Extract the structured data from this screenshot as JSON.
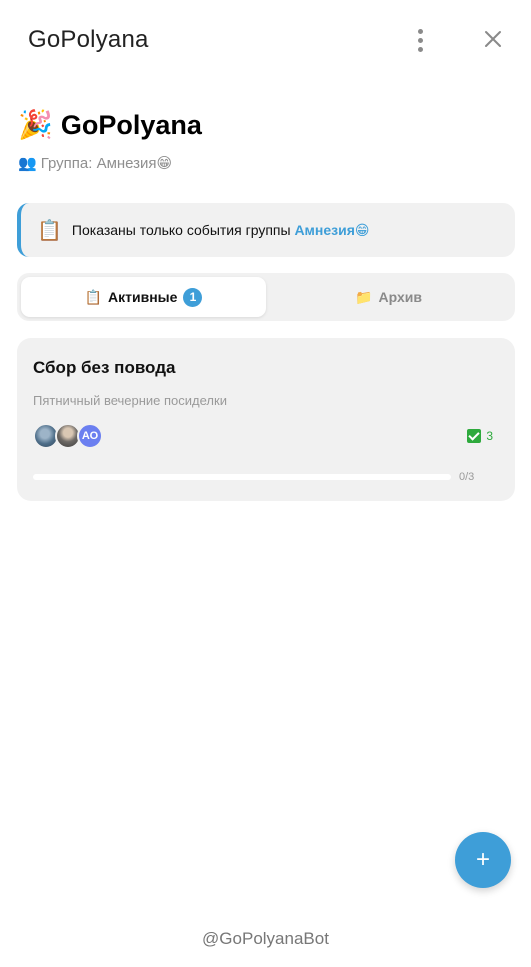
{
  "topbar": {
    "title": "GoPolyana",
    "icons": [
      "more-vertical-icon",
      "close-icon"
    ]
  },
  "header": {
    "emoji": "🎉",
    "title": "GoPolyana",
    "group_icon": "👥",
    "group_line": "Группа: Амнезия😁"
  },
  "notice": {
    "icon": "📋",
    "text": "Показаны только события группы",
    "group_name": "Амнезия😁",
    "accent_color": "#3e9ed8"
  },
  "tabs": [
    {
      "icon": "📋",
      "label": "Активные",
      "count": "1",
      "active": true
    },
    {
      "icon": "📁",
      "label": "Архив",
      "active": false
    }
  ],
  "events": [
    {
      "title": "Сбор без повода",
      "description": "Пятничный вечерние посиделки",
      "participants": [
        {
          "kind": "photo"
        },
        {
          "kind": "photo"
        },
        {
          "kind": "initials",
          "initials": "АО"
        }
      ],
      "checks_count": "3",
      "progress": {
        "done": 0,
        "total": 3,
        "text": "0/3"
      }
    }
  ],
  "fab": {
    "label": "+"
  },
  "footer": {
    "text": "@GoPolyanaBot"
  }
}
